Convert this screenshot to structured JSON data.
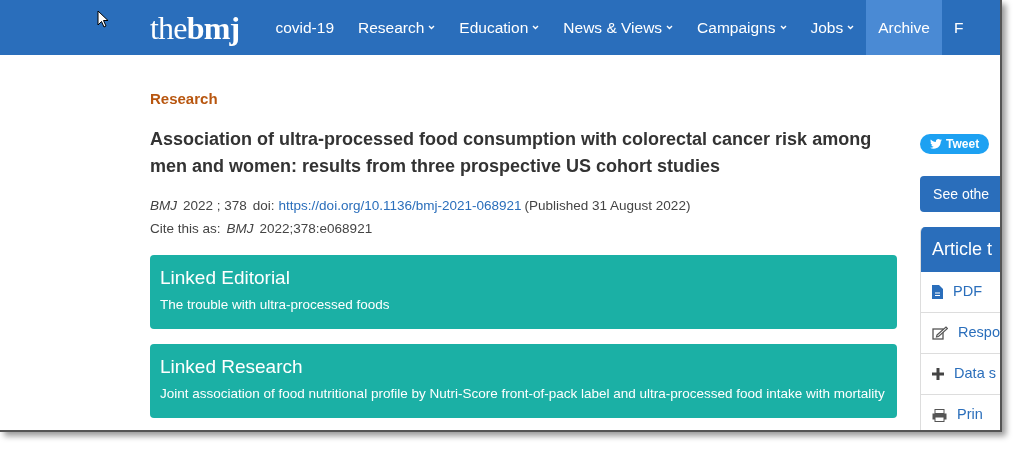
{
  "logo": "the**bmj**",
  "nav": [
    {
      "label": "covid-19",
      "dropdown": false,
      "selected": false
    },
    {
      "label": "Research",
      "dropdown": true,
      "selected": false
    },
    {
      "label": "Education",
      "dropdown": true,
      "selected": false
    },
    {
      "label": "News & Views",
      "dropdown": true,
      "selected": false
    },
    {
      "label": "Campaigns",
      "dropdown": true,
      "selected": false
    },
    {
      "label": "Jobs",
      "dropdown": true,
      "selected": false
    },
    {
      "label": "Archive",
      "dropdown": false,
      "selected": true
    },
    {
      "label": "F",
      "dropdown": false,
      "selected": false
    }
  ],
  "section": "Research",
  "title": "Association of ultra-processed food consumption with colorectal cancer risk among men and women: results from three prospective US cohort studies",
  "citation": {
    "journal": "BMJ",
    "year_volume": "2022 ; 378",
    "doi_label": "doi:",
    "doi": "https://doi.org/10.1136/bmj-2021-068921",
    "published": "(Published 31 August 2022)",
    "cite_label": "Cite this as:",
    "cite_journal": "BMJ",
    "cite_ref": "2022;378:e068921"
  },
  "linked": [
    {
      "heading": "Linked Editorial",
      "text": "The trouble with ultra-processed foods"
    },
    {
      "heading": "Linked Research",
      "text": "Joint association of food nutritional profile by Nutri-Score front-of-pack label and ultra-processed food intake with mortality"
    }
  ],
  "sidebar": {
    "tweet": "Tweet",
    "see_other": "See othe",
    "tools_title": "Article t",
    "tools": [
      {
        "kind": "pdf",
        "label": "PDF"
      },
      {
        "kind": "edit",
        "label": "Respo"
      },
      {
        "kind": "plus",
        "label": "Data s"
      },
      {
        "kind": "print",
        "label": "Prin"
      }
    ]
  }
}
